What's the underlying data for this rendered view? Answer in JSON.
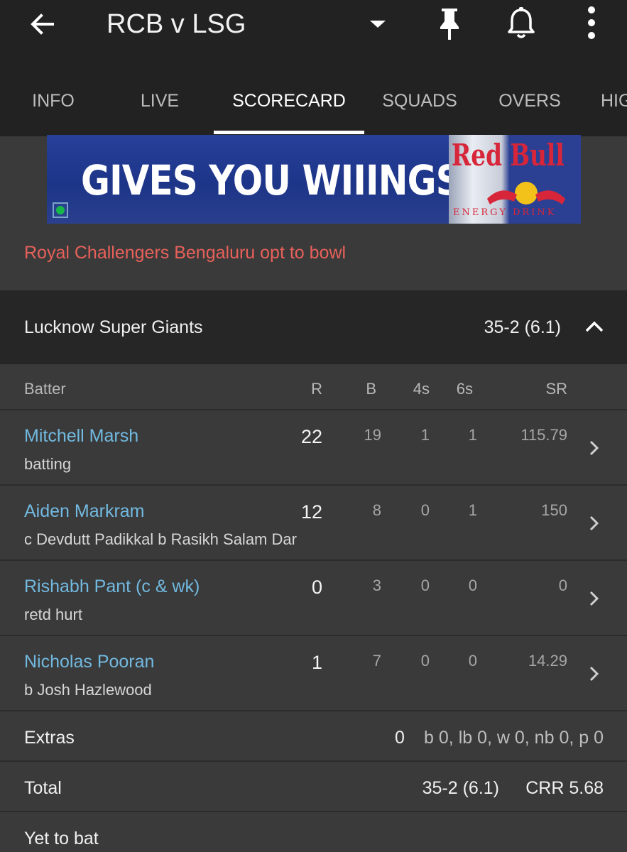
{
  "header": {
    "title": "RCB v LSG",
    "icons": [
      "back-arrow-icon",
      "dropdown-caret-icon",
      "pin-icon",
      "bell-icon",
      "more-vert-icon"
    ]
  },
  "tabs": [
    {
      "label": "INFO"
    },
    {
      "label": "LIVE"
    },
    {
      "label": "SCORECARD",
      "active": true
    },
    {
      "label": "SQUADS"
    },
    {
      "label": "OVERS"
    },
    {
      "label": "HIG"
    }
  ],
  "ad": {
    "text": "GIVES YOU WIIINGS.",
    "brand": "Red Bull",
    "sub": "ENERGY DRINK"
  },
  "toss": "Royal Challengers Bengaluru opt to bowl",
  "innings": {
    "team": "Lucknow Super Giants",
    "score": "35-2 (6.1)"
  },
  "columns": {
    "batter": "Batter",
    "r": "R",
    "b": "B",
    "fours": "4s",
    "sixes": "6s",
    "sr": "SR"
  },
  "batters": [
    {
      "name": "Mitchell Marsh",
      "dismissal": "batting",
      "r": "22",
      "b": "19",
      "fours": "1",
      "sixes": "1",
      "sr": "115.79"
    },
    {
      "name": "Aiden Markram",
      "dismissal": "c Devdutt Padikkal b Rasikh Salam Dar",
      "r": "12",
      "b": "8",
      "fours": "0",
      "sixes": "1",
      "sr": "150"
    },
    {
      "name": "Rishabh Pant (c & wk)",
      "dismissal": "retd hurt",
      "r": "0",
      "b": "3",
      "fours": "0",
      "sixes": "0",
      "sr": "0"
    },
    {
      "name": "Nicholas Pooran",
      "dismissal": "b Josh Hazlewood",
      "r": "1",
      "b": "7",
      "fours": "0",
      "sixes": "0",
      "sr": "14.29"
    }
  ],
  "extras": {
    "label": "Extras",
    "value": "0",
    "detail": "b 0, lb 0, w 0, nb 0, p 0"
  },
  "total": {
    "label": "Total",
    "score": "35-2 (6.1)",
    "crr": "CRR 5.68"
  },
  "yet_to_bat": {
    "label": "Yet to bat"
  },
  "colors": {
    "appbar": "#222222",
    "background": "#3a3a3a",
    "player_link": "#72b9e0",
    "toss_text": "#e8615a"
  }
}
